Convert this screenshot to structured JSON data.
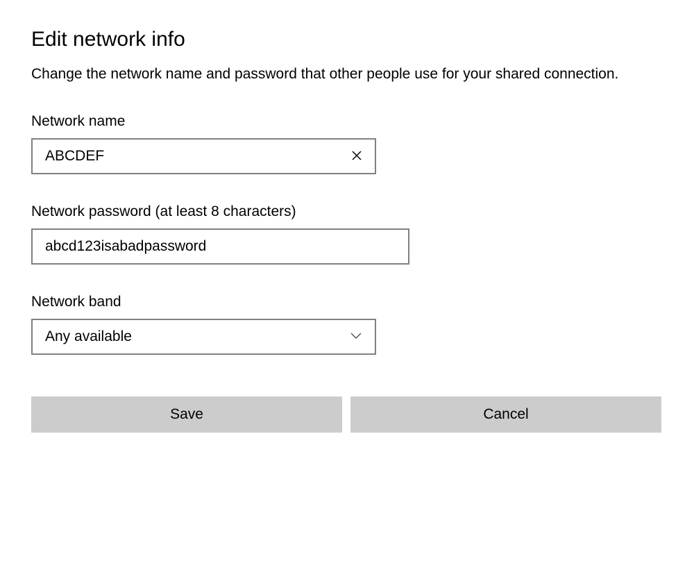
{
  "dialog": {
    "title": "Edit network info",
    "description": "Change the network name and password that other people use for your shared connection."
  },
  "fields": {
    "networkName": {
      "label": "Network name",
      "value": "ABCDEF"
    },
    "networkPassword": {
      "label": "Network password (at least 8 characters)",
      "value": "abcd123isabadpassword"
    },
    "networkBand": {
      "label": "Network band",
      "value": "Any available"
    }
  },
  "buttons": {
    "save": "Save",
    "cancel": "Cancel"
  }
}
